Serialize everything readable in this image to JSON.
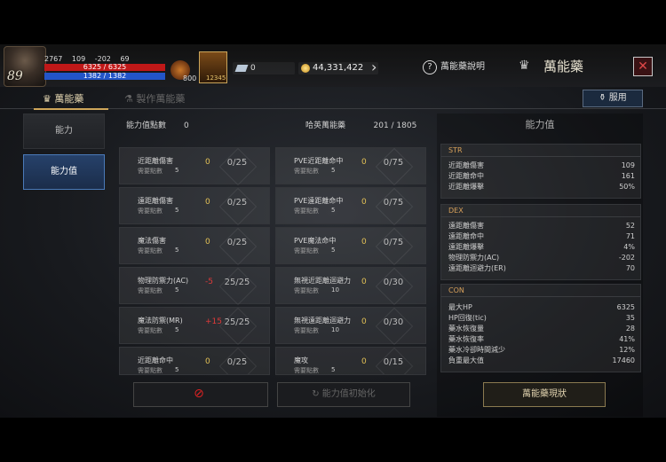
{
  "player": {
    "level": "89",
    "stat_a": "2767",
    "stat_b": "109",
    "stat_c": "-202",
    "stat_d": "69",
    "hp": "6325 / 6325",
    "mp": "1382 / 1382"
  },
  "buffs": [
    {
      "icon": "potion-icon",
      "count": "800"
    },
    {
      "icon": "elixir-icon",
      "count": "12345"
    }
  ],
  "currency": {
    "gems": "0",
    "gold": "44,331,422"
  },
  "header": {
    "help_label": "萬能藥說明",
    "title": "萬能藥",
    "close": "✕"
  },
  "tabs": [
    {
      "label": "萬能藥"
    },
    {
      "label": "製作萬能藥"
    }
  ],
  "use_button": "服用",
  "sidebar": [
    {
      "label": "能力"
    },
    {
      "label": "能力值"
    }
  ],
  "points": {
    "label": "能力值點數",
    "value": "0",
    "remain_label": "哈英萬能藥",
    "remain_value": "201 / 1805"
  },
  "required_label": "需要點數",
  "stats_left": [
    {
      "name": "近距離傷害",
      "req": "5",
      "val": "0",
      "max": "0/25",
      "red": false
    },
    {
      "name": "遠距離傷害",
      "req": "5",
      "val": "0",
      "max": "0/25",
      "red": false
    },
    {
      "name": "魔法傷害",
      "req": "5",
      "val": "0",
      "max": "0/25",
      "red": false
    },
    {
      "name": "物理防禦力(AC)",
      "req": "5",
      "val": "-5",
      "max": "25/25",
      "red": true
    },
    {
      "name": "魔法防禦(MR)",
      "req": "5",
      "val": "+15",
      "max": "25/25",
      "red": true
    },
    {
      "name": "近距離命中",
      "req": "5",
      "val": "0",
      "max": "0/25",
      "red": false
    }
  ],
  "stats_right": [
    {
      "name": "PVE近距離命中",
      "req": "5",
      "val": "0",
      "max": "0/75"
    },
    {
      "name": "PVE遠距離命中",
      "req": "5",
      "val": "0",
      "max": "0/75"
    },
    {
      "name": "PVE魔法命中",
      "req": "5",
      "val": "0",
      "max": "0/75"
    },
    {
      "name": "無視近距離迴避力",
      "req": "10",
      "val": "0",
      "max": "0/30"
    },
    {
      "name": "無視遠距離迴避力",
      "req": "10",
      "val": "0",
      "max": "0/30"
    },
    {
      "name": "魔攻",
      "req": "5",
      "val": "0",
      "max": "0/15"
    }
  ],
  "panel": {
    "title": "能力值",
    "str": {
      "header": "STR",
      "rows": [
        {
          "k": "近距離傷害",
          "v": "109"
        },
        {
          "k": "近距離命中",
          "v": "161"
        },
        {
          "k": "近距離爆擊",
          "v": "50%"
        }
      ]
    },
    "dex": {
      "header": "DEX",
      "rows": [
        {
          "k": "遠距離傷害",
          "v": "52"
        },
        {
          "k": "遠距離命中",
          "v": "71"
        },
        {
          "k": "遠距離爆擊",
          "v": "4%"
        },
        {
          "k": "物理防禦力(AC)",
          "v": "-202"
        },
        {
          "k": "遠距離迴避力(ER)",
          "v": "70"
        }
      ]
    },
    "con": {
      "header": "CON",
      "rows": [
        {
          "k": "最大HP",
          "v": "6325"
        },
        {
          "k": "HP回復(tic)",
          "v": "35"
        },
        {
          "k": "藥水恢復量",
          "v": "28"
        },
        {
          "k": "藥水恢復率",
          "v": "41%"
        },
        {
          "k": "藥水冷卻時間減少",
          "v": "12%"
        },
        {
          "k": "負重最大值",
          "v": "17460"
        }
      ]
    }
  },
  "bottom": {
    "btn1": "",
    "btn2": "能力值初始化",
    "btn3": "萬能藥現狀"
  }
}
